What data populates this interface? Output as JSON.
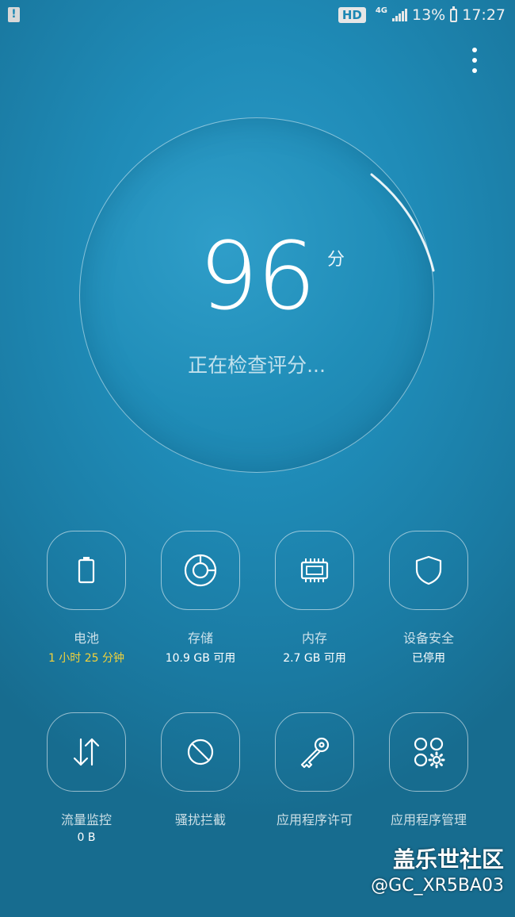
{
  "status_bar": {
    "notification_icon": "alert-icon",
    "hd_label": "HD",
    "network_label": "4G",
    "battery_percent": "13%",
    "time": "17:27"
  },
  "score": {
    "value": "96",
    "unit": "分",
    "status": "正在检查评分..."
  },
  "tiles": [
    {
      "label": "电池",
      "sub": "1 小时 25 分钟",
      "icon": "battery-icon"
    },
    {
      "label": "存储",
      "sub": "10.9 GB 可用",
      "icon": "storage-pie-icon"
    },
    {
      "label": "内存",
      "sub": "2.7 GB 可用",
      "icon": "memory-chip-icon"
    },
    {
      "label": "设备安全",
      "sub": "已停用",
      "icon": "shield-icon"
    },
    {
      "label": "流量监控",
      "sub": "0 B",
      "icon": "data-transfer-icon"
    },
    {
      "label": "骚扰拦截",
      "sub": "",
      "icon": "block-icon"
    },
    {
      "label": "应用程序许可",
      "sub": "",
      "icon": "key-icon"
    },
    {
      "label": "应用程序管理",
      "sub": "",
      "icon": "apps-gear-icon"
    }
  ],
  "colors": {
    "accent_warning": "#f3d23a",
    "background": "#1f8bb7"
  },
  "watermark": {
    "site": "盖乐世社区",
    "user": "@GC_XR5BA03"
  }
}
